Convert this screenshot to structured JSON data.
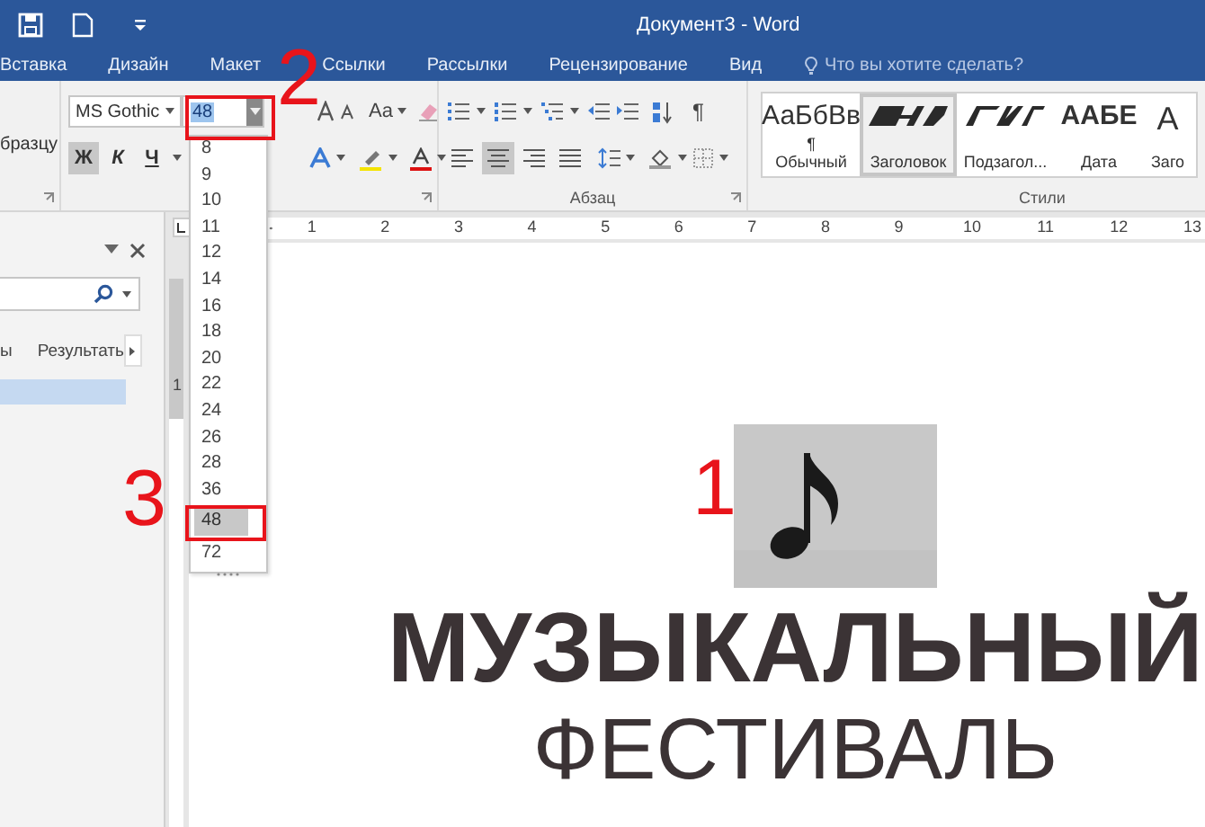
{
  "window": {
    "title": "Документ3 - Word"
  },
  "tabs": [
    {
      "label": "Вставка",
      "selected": false
    },
    {
      "label": "Дизайн",
      "selected": false
    },
    {
      "label": "Макет",
      "selected": false
    },
    {
      "label": "Ссылки",
      "selected": false
    },
    {
      "label": "Рассылки",
      "selected": false
    },
    {
      "label": "Рецензирование",
      "selected": false
    },
    {
      "label": "Вид",
      "selected": false
    }
  ],
  "tell_me": {
    "placeholder": "Что вы хотите сделать?"
  },
  "ribbon": {
    "clipboard": {
      "format_painter": "бразцу"
    },
    "font": {
      "name": "MS Gothic",
      "size": "48",
      "change_case": "Aa",
      "bold": {
        "label": "Ж",
        "on": true
      },
      "italic": {
        "label": "К",
        "on": false
      },
      "underline": {
        "label": "Ч",
        "on": false
      }
    },
    "paragraph": {
      "label": "Абзац",
      "pilcrow": "¶",
      "align_buttons": [
        {
          "kind": "left",
          "selected": false
        },
        {
          "kind": "center",
          "selected": true
        },
        {
          "kind": "right",
          "selected": false
        },
        {
          "kind": "justify",
          "selected": false
        }
      ]
    },
    "styles": {
      "label": "Стили",
      "items": [
        {
          "kind": "text",
          "preview": "АаБбВв",
          "name": "¶ Обычный",
          "selected": false
        },
        {
          "kind": "glyph",
          "name": "Заголовок",
          "selected": true
        },
        {
          "kind": "glyph",
          "name": "Подзагол...",
          "selected": false
        },
        {
          "kind": "text",
          "preview": "ААБЕ",
          "name": "Дата",
          "selected": false
        },
        {
          "kind": "text",
          "preview": "А",
          "name": "Заго",
          "selected": false
        }
      ]
    }
  },
  "size_list": {
    "items": [
      {
        "label": "8",
        "selected": false
      },
      {
        "label": "9",
        "selected": false
      },
      {
        "label": "10",
        "selected": false
      },
      {
        "label": "11",
        "selected": false
      },
      {
        "label": "12",
        "selected": false
      },
      {
        "label": "14",
        "selected": false
      },
      {
        "label": "16",
        "selected": false
      },
      {
        "label": "18",
        "selected": false
      },
      {
        "label": "20",
        "selected": false
      },
      {
        "label": "22",
        "selected": false
      },
      {
        "label": "24",
        "selected": false
      },
      {
        "label": "26",
        "selected": false
      },
      {
        "label": "28",
        "selected": false
      },
      {
        "label": "36",
        "selected": false
      },
      {
        "label": "48",
        "selected": true
      },
      {
        "label": "72",
        "selected": false
      }
    ]
  },
  "ruler": {
    "marks": [
      "1",
      "2",
      "3",
      "4",
      "5",
      "6",
      "7",
      "8",
      "9",
      "10",
      "11",
      "12",
      "13"
    ]
  },
  "vertical_ruler": {
    "marks": [
      "1"
    ]
  },
  "navigation": {
    "tabs": [
      {
        "label": "ы",
        "selected": false
      },
      {
        "label": "Результать",
        "selected": false
      }
    ]
  },
  "document": {
    "title": "МУЗЫКАЛЬНЫЙ",
    "subtitle": "ФЕСТИВАЛЬ"
  },
  "annotations": [
    {
      "label": "1",
      "boxed": false
    },
    {
      "label": "2",
      "boxed": true
    },
    {
      "label": "3",
      "boxed": true
    }
  ]
}
